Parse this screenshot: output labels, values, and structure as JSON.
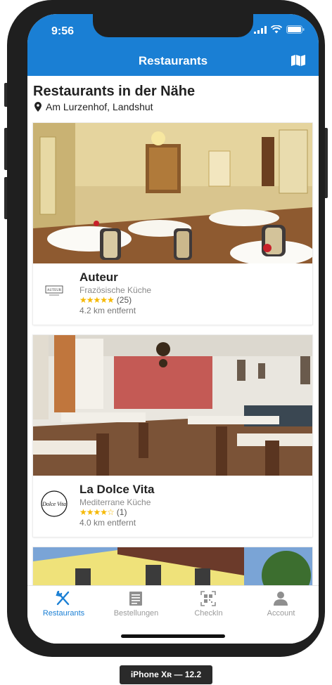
{
  "status_bar": {
    "time": "9:56"
  },
  "nav": {
    "title": "Restaurants",
    "map_icon": "map-icon"
  },
  "header": {
    "title": "Restaurants in der Nähe",
    "location": "Am Lurzenhof, Landshut"
  },
  "restaurants": [
    {
      "name": "Auteur",
      "cuisine": "Frazösische Küche",
      "rating": 4.5,
      "stars": "★★★★★",
      "reviews": "(25)",
      "distance": "4.2 km entfernt",
      "logo_text": "AUTEUR"
    },
    {
      "name": "La Dolce Vita",
      "cuisine": "Mediterrane Küche",
      "rating": 4,
      "stars": "★★★★☆",
      "reviews": "(1)",
      "distance": "4.0 km entfernt",
      "logo_text": "Dolce Vita"
    }
  ],
  "tabs": [
    {
      "label": "Restaurants",
      "icon": "cutlery-icon",
      "active": true
    },
    {
      "label": "Bestellungen",
      "icon": "receipt-icon",
      "active": false
    },
    {
      "label": "CheckIn",
      "icon": "qr-code-icon",
      "active": false
    },
    {
      "label": "Account",
      "icon": "user-icon",
      "active": false
    }
  ],
  "device_label": "iPhone Xʀ — 12.2",
  "colors": {
    "primary": "#1a7fd4",
    "star": "#f5b800"
  }
}
